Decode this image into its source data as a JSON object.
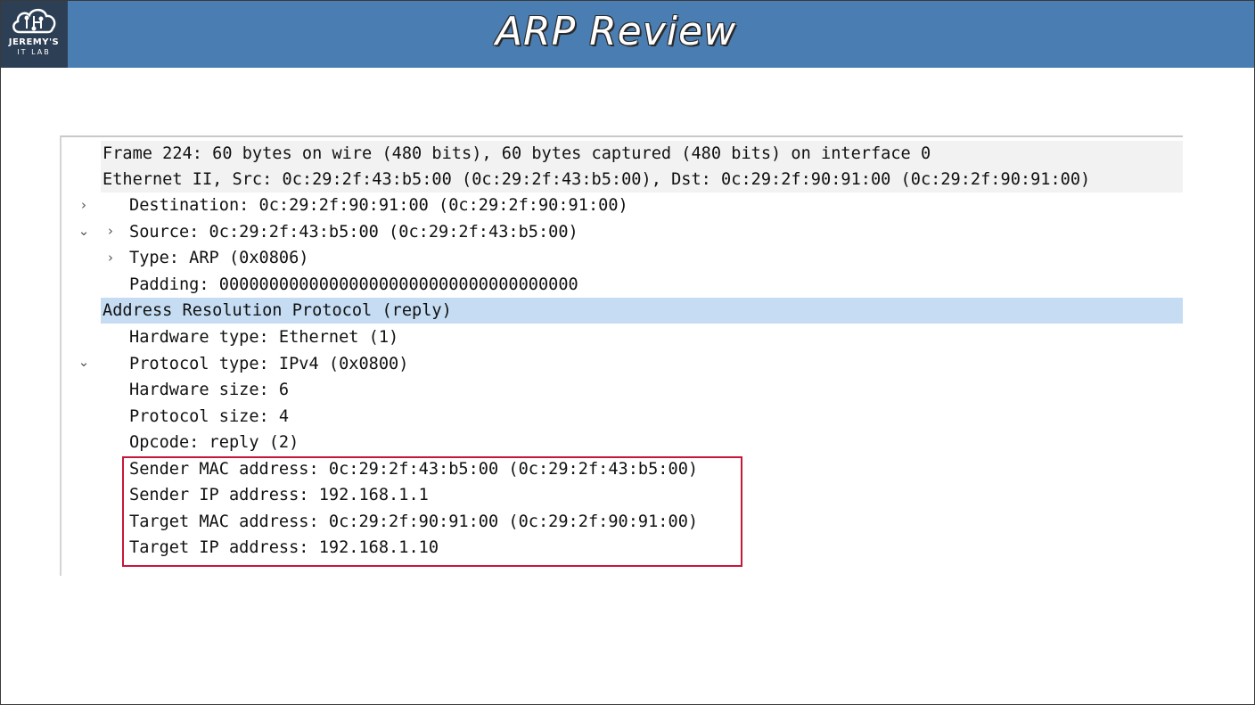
{
  "header": {
    "title": "ARP Review",
    "logo_line1": "JEREMY'S",
    "logo_line2": "IT LAB",
    "color": "#4a7db2",
    "logo_bg": "#2d3f55"
  },
  "packet_tree": {
    "selected_color": "#c5dcf3",
    "rows": [
      {
        "caret": "›",
        "text": "Frame 224: 60 bytes on wire (480 bits), 60 bytes captured (480 bits) on interface 0"
      },
      {
        "caret": "⌄",
        "text": "Ethernet II, Src: 0c:29:2f:43:b5:00 (0c:29:2f:43:b5:00), Dst: 0c:29:2f:90:91:00 (0c:29:2f:90:91:00)"
      },
      {
        "caret": "›",
        "text": "Destination: 0c:29:2f:90:91:00 (0c:29:2f:90:91:00)"
      },
      {
        "caret": "›",
        "text": "Source: 0c:29:2f:43:b5:00 (0c:29:2f:43:b5:00)"
      },
      {
        "caret": "",
        "text": "Type: ARP (0x0806)"
      },
      {
        "caret": "",
        "text": "Padding: 000000000000000000000000000000000000"
      },
      {
        "caret": "⌄",
        "text": "Address Resolution Protocol (reply)"
      },
      {
        "caret": "",
        "text": "Hardware type: Ethernet (1)"
      },
      {
        "caret": "",
        "text": "Protocol type: IPv4 (0x0800)"
      },
      {
        "caret": "",
        "text": "Hardware size: 6"
      },
      {
        "caret": "",
        "text": "Protocol size: 4"
      },
      {
        "caret": "",
        "text": "Opcode: reply (2)"
      },
      {
        "caret": "",
        "text": "Sender MAC address: 0c:29:2f:43:b5:00 (0c:29:2f:43:b5:00)"
      },
      {
        "caret": "",
        "text": "Sender IP address: 192.168.1.1"
      },
      {
        "caret": "",
        "text": "Target MAC address: 0c:29:2f:90:91:00 (0c:29:2f:90:91:00)"
      },
      {
        "caret": "",
        "text": "Target IP address: 192.168.1.10"
      }
    ]
  },
  "highlight": {
    "color": "#c8163a"
  }
}
